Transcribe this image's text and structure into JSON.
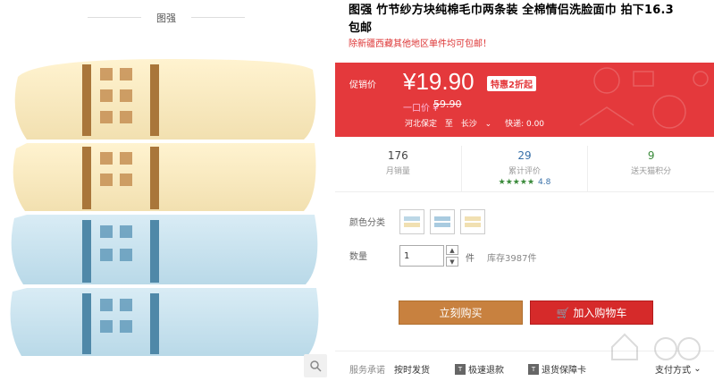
{
  "gallery": {
    "brand_caption": "图强",
    "zoom_icon": "magnifier-icon"
  },
  "product": {
    "title_line1": "图强 竹节纱方块纯棉毛巾两条装 全棉情侣洗脸面巾 拍下16.3",
    "title_line2": "包邮",
    "subtitle": "除新疆西藏其他地区单件均可包邮！"
  },
  "price": {
    "label": "促销价",
    "current": "¥19.90",
    "promo_tag": "特惠2折起",
    "original_label": "一口价 ¥",
    "original": "59.90",
    "ship_from": "河北保定",
    "ship_to_label": "至",
    "ship_to": "长沙",
    "ship_fee_label": "快递: 0.00"
  },
  "stats": [
    {
      "value": "176",
      "label": "月销量"
    },
    {
      "value": "29",
      "label": "累计评价",
      "rating": "★★★★★",
      "score": "4.8"
    },
    {
      "value": "9",
      "label": "送天猫积分"
    }
  ],
  "options": {
    "color_label": "颜色分类",
    "qty_label": "数量",
    "qty_value": "1",
    "qty_unit": "件",
    "stock": "库存3987件"
  },
  "actions": {
    "buy_now": "立刻购买",
    "add_to_cart": "加入购物车"
  },
  "service": {
    "label": "服务承诺",
    "item1": "按时发货",
    "item2": "极速退款",
    "item3": "退货保障卡",
    "item4": "支付方式"
  },
  "colors": {
    "accent_red": "#e4393c",
    "buy_orange": "#c8813f",
    "cart_red": "#d62a2a"
  }
}
